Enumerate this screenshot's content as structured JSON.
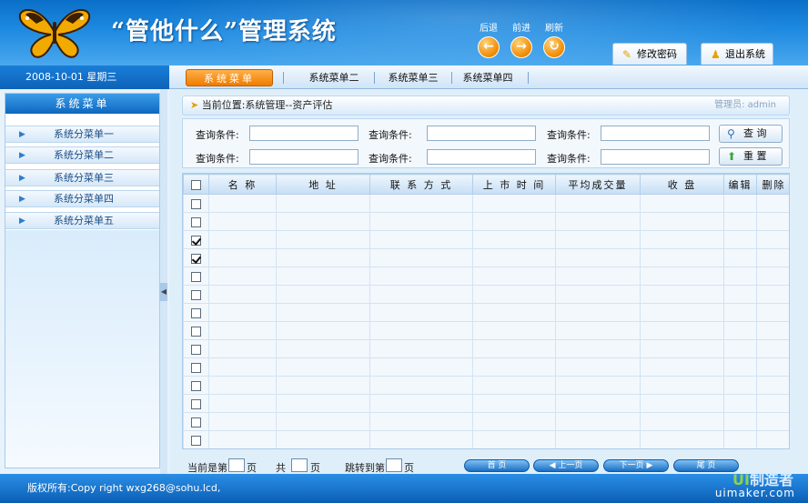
{
  "header": {
    "title": "“管他什么”管理系统",
    "nav": {
      "back": "后退",
      "forward": "前进",
      "refresh": "刷新"
    },
    "buttons": {
      "change_password": "修改密码",
      "logout": "退出系统"
    }
  },
  "datebar": {
    "date": "2008-10-01 星期三"
  },
  "tabs": [
    "系统菜单",
    "系统菜单二",
    "系统菜单三",
    "系统菜单四"
  ],
  "sidebar": {
    "title": "系统菜单",
    "items": [
      {
        "label": "系统分菜单一"
      },
      {
        "label": "系统分菜单二"
      },
      {
        "label": "系统分菜单三"
      },
      {
        "label": "系统分菜单四"
      },
      {
        "label": "系统分菜单五"
      }
    ]
  },
  "breadcrumb": {
    "text": "当前位置:系统管理--资产评估",
    "admin": "管理员: admin"
  },
  "query": {
    "label": "查询条件:",
    "search_label": "查 询",
    "reset_label": "重 置"
  },
  "table": {
    "headers": [
      "名 称",
      "地 址",
      "联 系 方 式",
      "上 市 时 间",
      "平均成交量",
      "收 盘",
      "编辑",
      "删除"
    ],
    "rows": [
      {
        "checked": false
      },
      {
        "checked": false
      },
      {
        "checked": true
      },
      {
        "checked": true
      },
      {
        "checked": false
      },
      {
        "checked": false
      },
      {
        "checked": false
      },
      {
        "checked": false
      },
      {
        "checked": false
      },
      {
        "checked": false
      },
      {
        "checked": false
      },
      {
        "checked": false
      },
      {
        "checked": false
      },
      {
        "checked": false
      }
    ]
  },
  "pager": {
    "current_prefix": "当前是第",
    "page_suffix": "页",
    "total_prefix": "共",
    "jump_prefix": "跳转到第",
    "first": "首 页",
    "prev": "上一页",
    "next": "下一页",
    "last": "尾 页"
  },
  "footer": {
    "copyright": "版权所有:Copy right wxg268@sohu.lcd,"
  },
  "watermark": {
    "brand_ui": "UI",
    "brand_rest": "制造者",
    "url": "uimaker.com"
  },
  "colors": {
    "accent": "#0d67c0",
    "tab_active": "#f07c00"
  }
}
